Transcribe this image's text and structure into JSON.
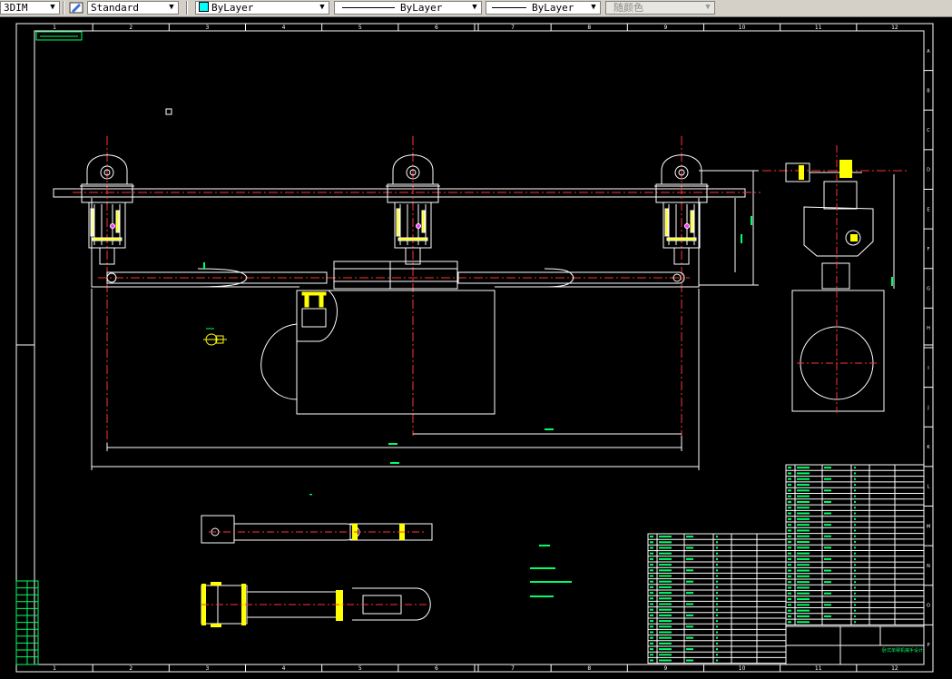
{
  "toolbar": {
    "dimstyle": "3DIM",
    "textstyle": "Standard",
    "layer_color": "ByLayer",
    "linetype": "ByLayer",
    "lineweight": "ByLayer",
    "plotstyle": "随颜色"
  },
  "drawing": {
    "column_labels": [
      "1",
      "2",
      "3",
      "4",
      "5",
      "6",
      "7",
      "8",
      "9",
      "10",
      "11",
      "12"
    ],
    "row_labels": [
      "A",
      "B",
      "C",
      "D",
      "E",
      "F",
      "G",
      "H",
      "I",
      "J",
      "K",
      "L",
      "M",
      "N",
      "O",
      "P"
    ],
    "title_block_text": "卧式单臂机械手设计",
    "colors": {
      "frame": "#ffffff",
      "part": "#ffffff",
      "center": "#ff3333",
      "hatch": "#ffff00",
      "dim": "#00ff66"
    }
  }
}
